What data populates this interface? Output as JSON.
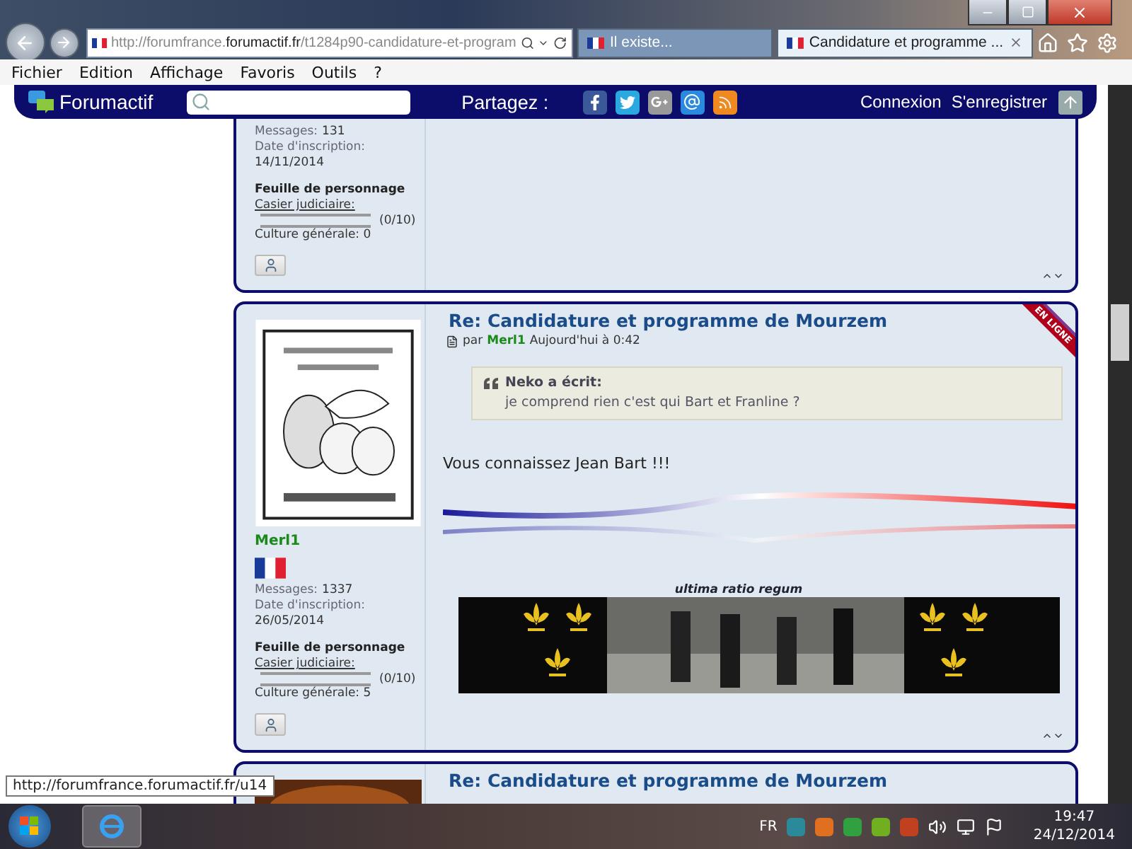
{
  "browser": {
    "address": "http://forumfrance.**forumactif.fr**/t1284p90-candidature-et-program",
    "tabs": [
      {
        "label": "Il existe...",
        "selected": false
      },
      {
        "label": "Candidature et programme ...",
        "selected": true
      }
    ]
  },
  "menu": [
    "Fichier",
    "Edition",
    "Affichage",
    "Favoris",
    "Outils",
    "?"
  ],
  "toolbar": {
    "brand": "Forumactif",
    "share": "Partagez :",
    "links": [
      "Connexion",
      "S'enregistrer"
    ]
  },
  "posts": [
    {
      "profile": {
        "messages_label": "Messages:",
        "messages": "131",
        "joined_label": "Date d'inscription:",
        "joined": "14/11/2014",
        "sheet_title": "Feuille de personnage",
        "gauge": {
          "label": "Casier judiciaire:",
          "level": 0,
          "reading": "(0/10)"
        },
        "culture": "Culture générale: 0"
      }
    },
    {
      "title": "Re: Candidature et programme de Mourzem",
      "meta": {
        "by": "par",
        "author": "Merl1",
        "date": "Aujourd'hui à 0:42"
      },
      "online_ribbon": "EN LIGNE",
      "username": "Merl1",
      "profile": {
        "messages_label": "Messages:",
        "messages": "1337",
        "joined_label": "Date d'inscription:",
        "joined": "26/05/2014",
        "sheet_title": "Feuille de personnage",
        "gauge": {
          "label": "Casier judiciaire:",
          "level": 0,
          "reading": "(0/10)"
        },
        "culture": "Culture générale: 5"
      },
      "quote": {
        "author": "Neko a écrit:",
        "text": "je comprend rien c'est qui Bart et Franline ?"
      },
      "body": "Vous connaissez Jean Bart !!!",
      "signature_caption": "ultima ratio regum"
    },
    {
      "title": "Re: Candidature et programme de Mourzem"
    }
  ],
  "status_url": "http://forumfrance.forumactif.fr/u14",
  "taskbar": {
    "language": "FR",
    "time": "19:47",
    "date": "24/12/2014"
  }
}
